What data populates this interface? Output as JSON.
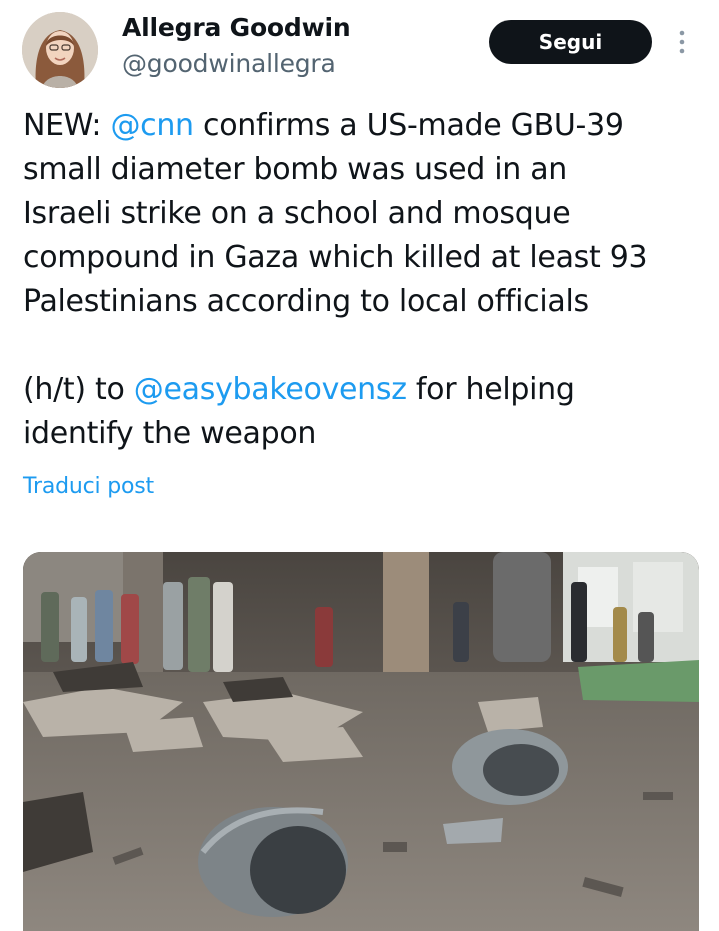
{
  "user": {
    "display_name": "Allegra Goodwin",
    "handle": "@goodwinallegra"
  },
  "actions": {
    "follow_label": "Segui"
  },
  "post": {
    "line1_prefix": "NEW: ",
    "mention1": "@cnn",
    "line1_rest": " confirms a US-made GBU-39\nsmall diameter bomb was used in an\nIsraeli strike on a school and mosque\ncompound in Gaza which killed at least 93\nPalestinians according to local officials\n\n(h/t) to ",
    "mention2": "@easybakeovensz",
    "line2_rest": " for helping\nidentify the weapon",
    "translate_label": "Traduci post"
  },
  "icons": {
    "more": "more-vertical-icon"
  },
  "colors": {
    "accent": "#1d9bf0",
    "text": "#0f1419",
    "secondary": "#536471",
    "button": "#0f1419"
  }
}
